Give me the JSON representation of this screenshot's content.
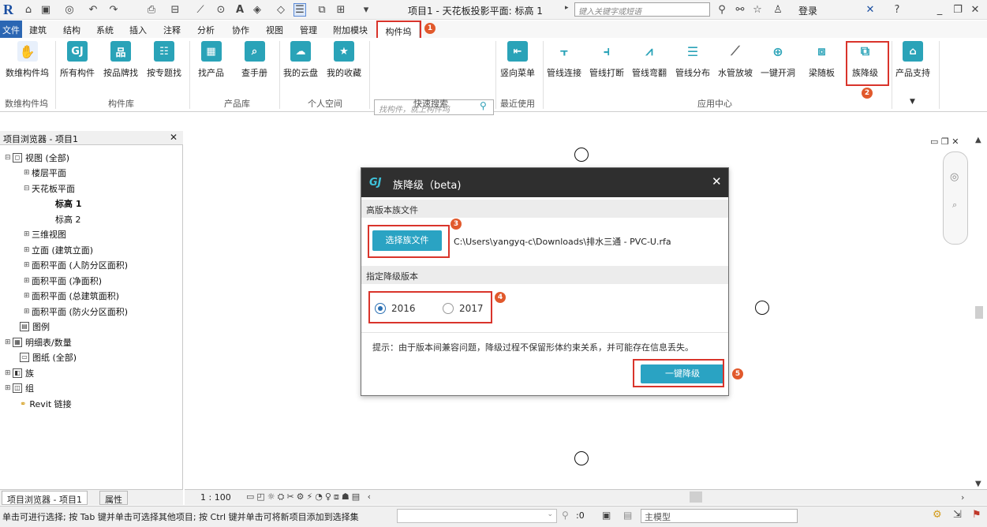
{
  "titlebar": {
    "document_title": "项目1 - 天花板投影平面: 标高 1",
    "search_placeholder": "键入关键字或短语",
    "login": "登录"
  },
  "ribbon_tabs": [
    {
      "label": "文件"
    },
    {
      "label": "建筑"
    },
    {
      "label": "结构"
    },
    {
      "label": "系统"
    },
    {
      "label": "插入"
    },
    {
      "label": "注释"
    },
    {
      "label": "分析"
    },
    {
      "label": "协作"
    },
    {
      "label": "视图"
    },
    {
      "label": "管理"
    },
    {
      "label": "附加模块"
    },
    {
      "label": "构件坞"
    }
  ],
  "ribbon": {
    "buttons": [
      {
        "label": "数维构件坞",
        "icon": "hand-cube-icon"
      },
      {
        "label": "所有构件",
        "icon": "gj-logo-icon"
      },
      {
        "label": "按品牌找",
        "icon": "brand-grid-icon"
      },
      {
        "label": "按专题找",
        "icon": "topic-grid-icon"
      },
      {
        "label": "找产品",
        "icon": "product-grid-icon"
      },
      {
        "label": "查手册",
        "icon": "manual-icon"
      },
      {
        "label": "我的云盘",
        "icon": "cloud-disk-icon"
      },
      {
        "label": "我的收藏",
        "icon": "star-icon"
      },
      {
        "label": "竖向菜单",
        "icon": "vertical-menu-icon"
      },
      {
        "label": "管线连接",
        "icon": "pipe-connect-icon"
      },
      {
        "label": "管线打断",
        "icon": "pipe-break-icon"
      },
      {
        "label": "管线弯翻",
        "icon": "pipe-bend-icon"
      },
      {
        "label": "管线分布",
        "icon": "pipe-distribute-icon"
      },
      {
        "label": "水管放坡",
        "icon": "pipe-slope-icon"
      },
      {
        "label": "一键开洞",
        "icon": "open-hole-icon"
      },
      {
        "label": "梁随板",
        "icon": "beam-follow-slab-icon"
      },
      {
        "label": "族降级",
        "icon": "family-downgrade-icon"
      },
      {
        "label": "产品支持",
        "icon": "home-support-icon"
      }
    ],
    "search_placeholder": "找构件，就上构件坞",
    "groups": [
      "数维构件坞",
      "构件库",
      "产品库",
      "个人空间",
      "快速搜索",
      "最近使用",
      "应用中心"
    ]
  },
  "callouts": [
    "1",
    "2",
    "3",
    "4",
    "5"
  ],
  "project_browser": {
    "title": "项目浏览器 - 项目1",
    "tree": [
      {
        "label": "视图 (全部)"
      },
      {
        "label": "楼层平面"
      },
      {
        "label": "天花板平面"
      },
      {
        "label": "标高 1"
      },
      {
        "label": "标高 2"
      },
      {
        "label": "三维视图"
      },
      {
        "label": "立面 (建筑立面)"
      },
      {
        "label": "面积平面 (人防分区面积)"
      },
      {
        "label": "面积平面 (净面积)"
      },
      {
        "label": "面积平面 (总建筑面积)"
      },
      {
        "label": "面积平面 (防火分区面积)"
      },
      {
        "label": "图例"
      },
      {
        "label": "明细表/数量"
      },
      {
        "label": "图纸 (全部)"
      },
      {
        "label": "族"
      },
      {
        "label": "组"
      },
      {
        "label": "Revit 链接"
      }
    ],
    "tabs": [
      "项目浏览器 - 项目1",
      "属性"
    ]
  },
  "viewbar": {
    "scale": "1 : 100"
  },
  "status": {
    "text": "单击可进行选择; 按 Tab 键并单击可选择其他项目; 按 Ctrl 键并单击可将新项目添加到选择集",
    "zero": ":0",
    "model": "主模型"
  },
  "dialog": {
    "title": "族降级（beta)",
    "section_file": "高版本族文件",
    "choose_button": "选择族文件",
    "file_path": "C:\\Users\\yangyq-c\\Downloads\\排水三通 - PVC-U.rfa",
    "section_version": "指定降级版本",
    "options": [
      {
        "label": "2016",
        "selected": true
      },
      {
        "label": "2017",
        "selected": false
      }
    ],
    "hint": "提示：由于版本间兼容问题，降级过程不保留形体约束关系，并可能存在信息丢失。",
    "downgrade_button": "一键降级"
  },
  "colors": {
    "accent": "#2aa3c3",
    "callout": "#d9342b",
    "badge": "#e1592c",
    "dialog_header": "#2f2f2f"
  }
}
